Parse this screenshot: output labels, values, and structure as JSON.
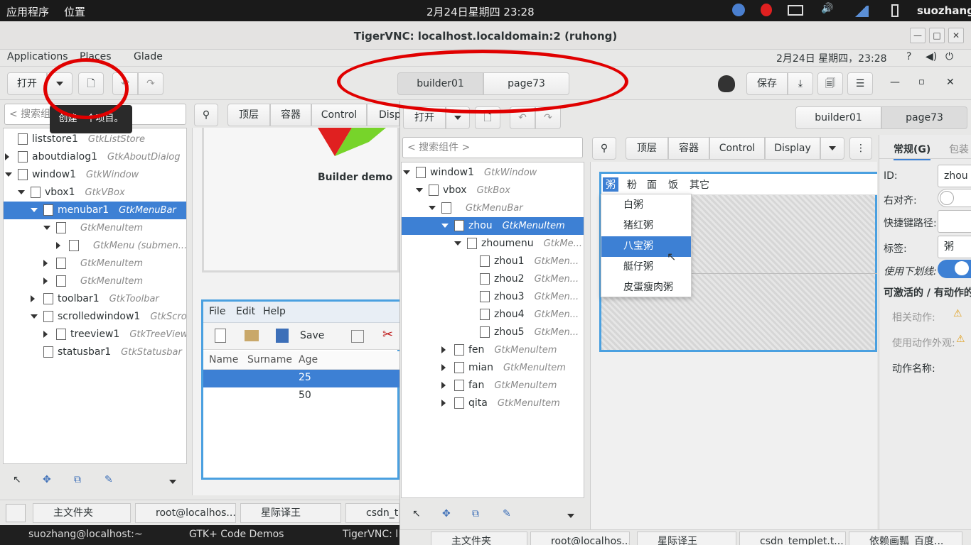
{
  "topbar": {
    "apps": "应用程序",
    "places": "位置",
    "clock": "2月24日星期四 23:28",
    "user": "suozhang"
  },
  "vnc": {
    "title": "TigerVNC: localhost.localdomain:2 (ruhong)"
  },
  "remote_bar": {
    "applications": "Applications",
    "places": "Places",
    "glade": "Glade",
    "clock": "2月24日 星期四，23:28"
  },
  "toolbar": {
    "open": "打开",
    "save": "保存",
    "tab1": "builder01",
    "tab2": "page73",
    "tooltip": "创建一个项目。"
  },
  "left_panel": {
    "search_placeholder": "< 搜索组件 >",
    "tree": [
      {
        "name": "liststore1",
        "type": "GtkListStore"
      },
      {
        "name": "aboutdialog1",
        "type": "GtkAboutDialog"
      },
      {
        "name": "window1",
        "type": "GtkWindow"
      },
      {
        "name": "vbox1",
        "type": "GtkVBox"
      },
      {
        "name": "menubar1",
        "type": "GtkMenuBar"
      },
      {
        "name": "",
        "type": "GtkMenuItem"
      },
      {
        "name": "",
        "type": "GtkMenu  (submen..."
      },
      {
        "name": "",
        "type": "GtkMenuItem"
      },
      {
        "name": "",
        "type": "GtkMenuItem"
      },
      {
        "name": "toolbar1",
        "type": "GtkToolbar"
      },
      {
        "name": "scrolledwindow1",
        "type": "GtkScro..."
      },
      {
        "name": "treeview1",
        "type": "GtkTreeView"
      },
      {
        "name": "statusbar1",
        "type": "GtkStatusbar"
      }
    ]
  },
  "palette": {
    "toplevel": "顶层",
    "container": "容器",
    "control": "Control",
    "display": "Displ"
  },
  "canvas": {
    "builder_demo": "Builder demo",
    "menu_file": "File",
    "menu_edit": "Edit",
    "menu_help": "Help",
    "save": "Save",
    "col_name": "Name",
    "col_surname": "Surname",
    "col_age": "Age",
    "row1_age": "25",
    "row2_age": "50"
  },
  "inner": {
    "open": "打开",
    "tab1": "builder01",
    "tab2": "page73",
    "search_placeholder": "< 搜索组件 >",
    "palette": {
      "toplevel": "顶层",
      "container": "容器",
      "control": "Control",
      "display": "Display"
    },
    "tree": [
      {
        "name": "window1",
        "type": "GtkWindow"
      },
      {
        "name": "vbox",
        "type": "GtkBox"
      },
      {
        "name": "",
        "type": "GtkMenuBar"
      },
      {
        "name": "zhou",
        "type": "GtkMenuItem"
      },
      {
        "name": "zhoumenu",
        "type": "GtkMe..."
      },
      {
        "name": "zhou1",
        "type": "GtkMen..."
      },
      {
        "name": "zhou2",
        "type": "GtkMen..."
      },
      {
        "name": "zhou3",
        "type": "GtkMen..."
      },
      {
        "name": "zhou4",
        "type": "GtkMen..."
      },
      {
        "name": "zhou5",
        "type": "GtkMen..."
      },
      {
        "name": "fen",
        "type": "GtkMenuItem"
      },
      {
        "name": "mian",
        "type": "GtkMenuItem"
      },
      {
        "name": "fan",
        "type": "GtkMenuItem"
      },
      {
        "name": "qita",
        "type": "GtkMenuItem"
      }
    ],
    "menubar": [
      "粥",
      "粉",
      "面",
      "饭",
      "其它"
    ],
    "dropdown": [
      "白粥",
      "猪红粥",
      "八宝粥",
      "艇仔粥",
      "皮蛋瘦肉粥"
    ],
    "props": {
      "tab_general": "常规(G)",
      "tab_pack": "包装",
      "id_label": "ID:",
      "id_value": "zhou",
      "right_align": "右对齐:",
      "accel": "快捷键路径:",
      "label": "标签:",
      "label_value": "粥",
      "underline": "使用下划线:",
      "activatable": "可激活的 / 有动作的",
      "related_action": "相关动作:",
      "action_appearance": "使用动作外观:",
      "action_name": "动作名称:"
    }
  },
  "taskbar_remote": [
    "主文件夹",
    "root@localhos...",
    "星际译王",
    "csdn_t"
  ],
  "taskbar_inner": [
    "主文件夹",
    "root@localhos...",
    "星际译王",
    "csdn_templet.t...",
    "依赖画瓢_百度..."
  ],
  "taskbar_local": [
    "suozhang@localhost:~",
    "GTK+ Code Demos",
    "TigerVNC: l"
  ]
}
